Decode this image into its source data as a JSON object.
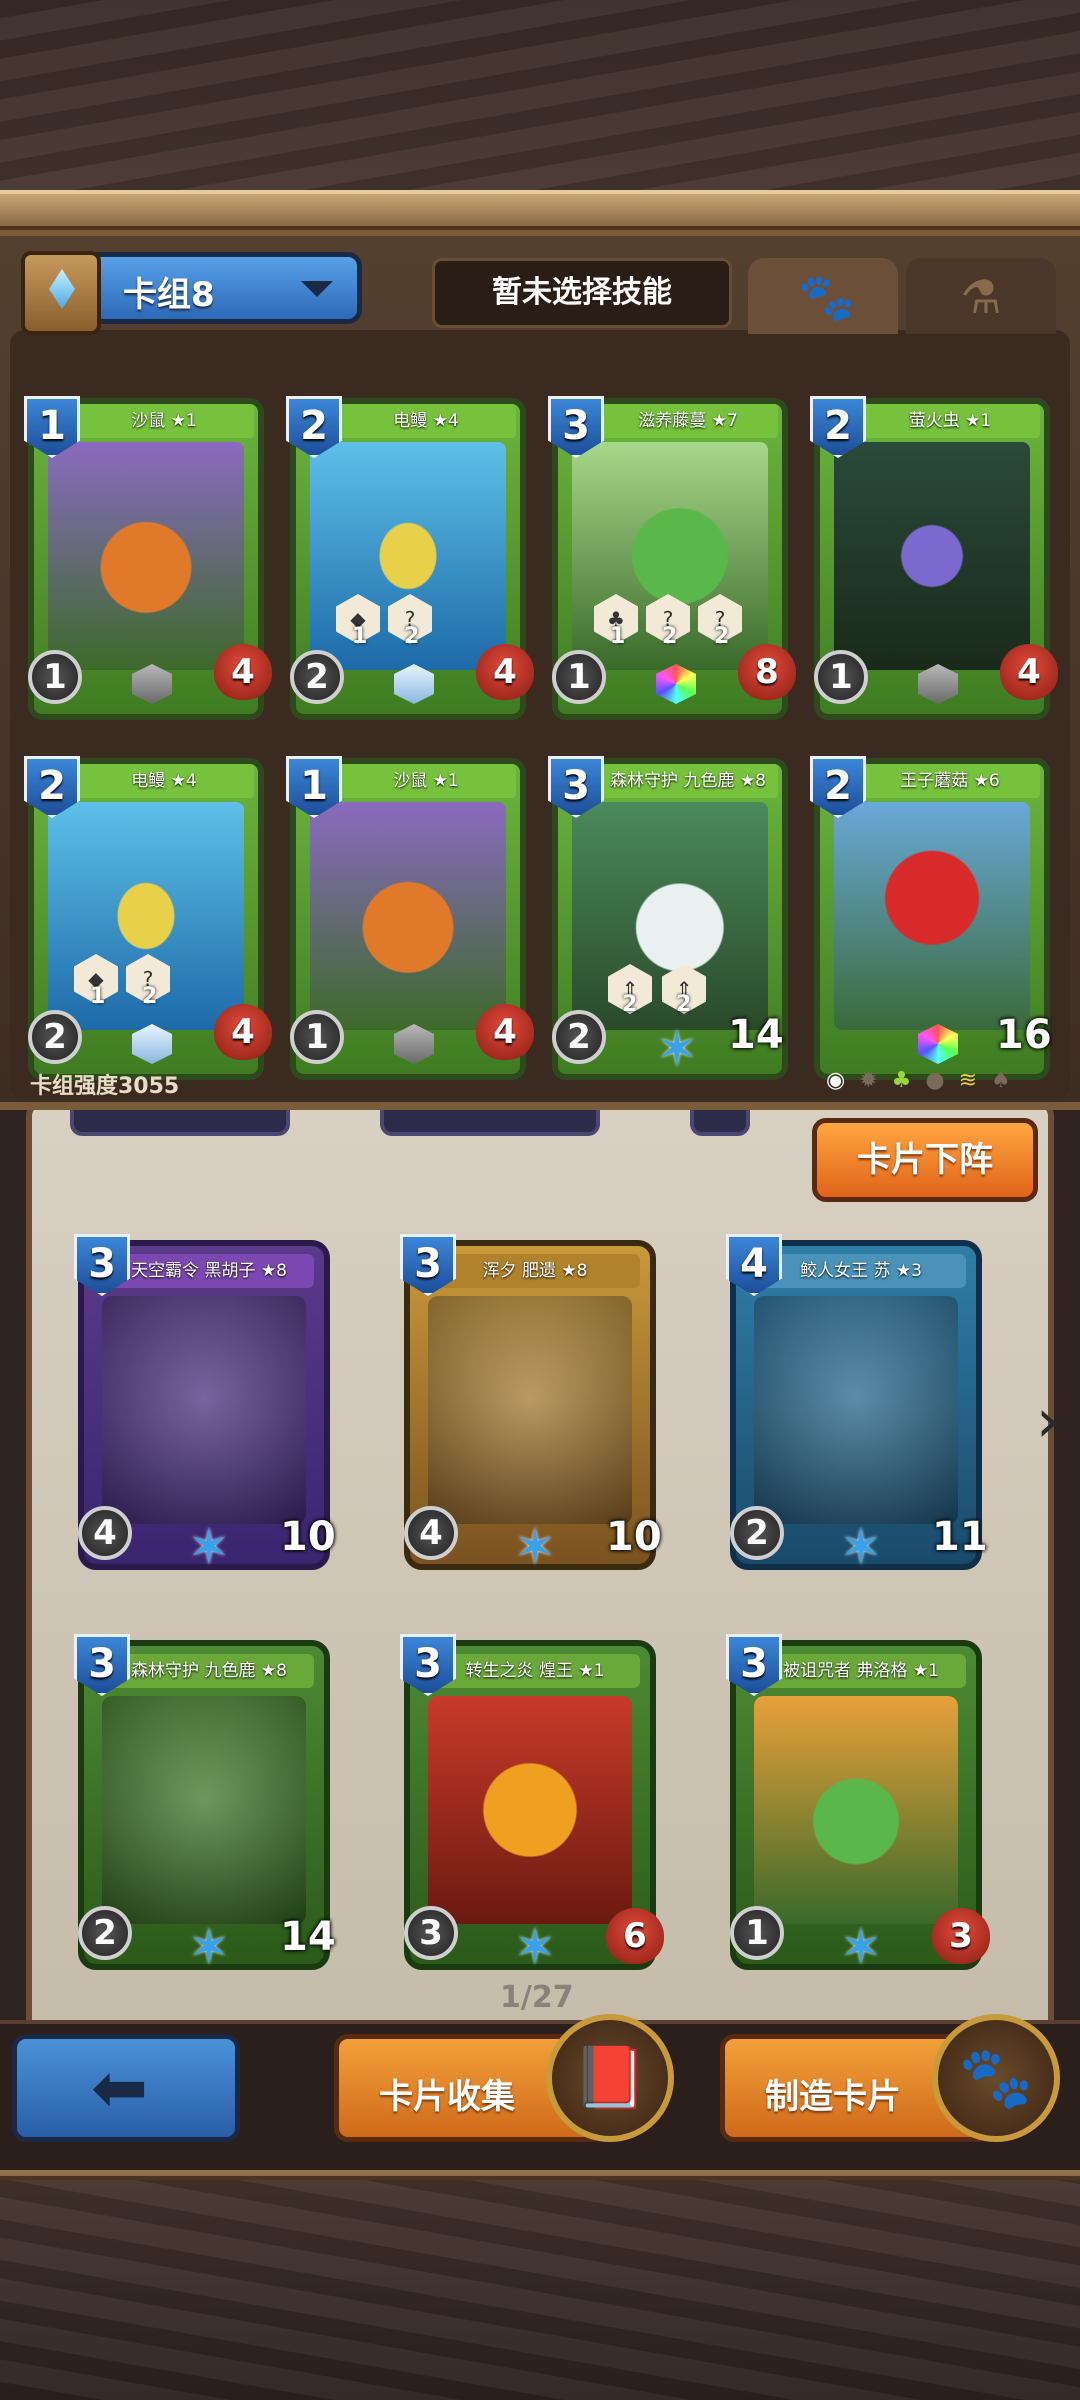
{
  "header": {
    "deck_name": "卡组8",
    "skill_button": "暂未选择技能",
    "tabs": [
      {
        "icon": "paw-icon",
        "active": true
      },
      {
        "icon": "potion-icon",
        "active": false
      }
    ]
  },
  "deck": {
    "strength_label": "卡组强度3055",
    "cards": [
      {
        "name": "沙鼠 ★1",
        "cost": "1",
        "attack": "1",
        "hp": "4",
        "art": "forest"
      },
      {
        "name": "电鳗 ★4",
        "cost": "2",
        "attack": "2",
        "hp": "4",
        "art": "water",
        "skills": [
          "1",
          "2"
        ]
      },
      {
        "name": "滋养藤蔓 ★7",
        "cost": "3",
        "attack": "1",
        "hp": "8",
        "art": "plant",
        "skills": [
          "1",
          "2",
          "2"
        ]
      },
      {
        "name": "萤火虫 ★1",
        "cost": "2",
        "attack": "1",
        "hp": "4",
        "art": "night"
      },
      {
        "name": "电鳗 ★4",
        "cost": "2",
        "attack": "2",
        "hp": "4",
        "art": "water",
        "skills": [
          "1",
          "2"
        ]
      },
      {
        "name": "沙鼠 ★1",
        "cost": "1",
        "attack": "1",
        "hp": "4",
        "art": "forest"
      },
      {
        "name": "森林守护 九色鹿 ★8",
        "cost": "3",
        "attack": "2",
        "hp": "14",
        "art": "deer",
        "skills": [
          "2",
          "2"
        ]
      },
      {
        "name": "王子蘑菇 ★6",
        "cost": "2",
        "attack": "",
        "hp": "16",
        "art": "mush"
      }
    ]
  },
  "actions": {
    "remove_card": "卡片下阵",
    "card_collection": "卡片收集",
    "craft_card": "制造卡片"
  },
  "collection": {
    "page": "1/27",
    "cards": [
      {
        "name": "天空霸令 黑胡子 ★8",
        "cost": "3",
        "attack": "4",
        "hp": "10",
        "theme": "purple"
      },
      {
        "name": "浑夕 肥遗 ★8",
        "cost": "3",
        "attack": "4",
        "hp": "10",
        "theme": "gold"
      },
      {
        "name": "鲛人女王 苏 ★3",
        "cost": "4",
        "attack": "2",
        "hp": "11",
        "theme": "blue"
      },
      {
        "name": "森林守护 九色鹿 ★8",
        "cost": "3",
        "attack": "2",
        "hp": "14",
        "theme": "green"
      },
      {
        "name": "转生之炎 煌王 ★1",
        "cost": "3",
        "attack": "3",
        "hp": "6",
        "theme": "green"
      },
      {
        "name": "被诅咒者 弗洛格 ★1",
        "cost": "3",
        "attack": "1",
        "hp": "3",
        "theme": "green"
      }
    ]
  }
}
